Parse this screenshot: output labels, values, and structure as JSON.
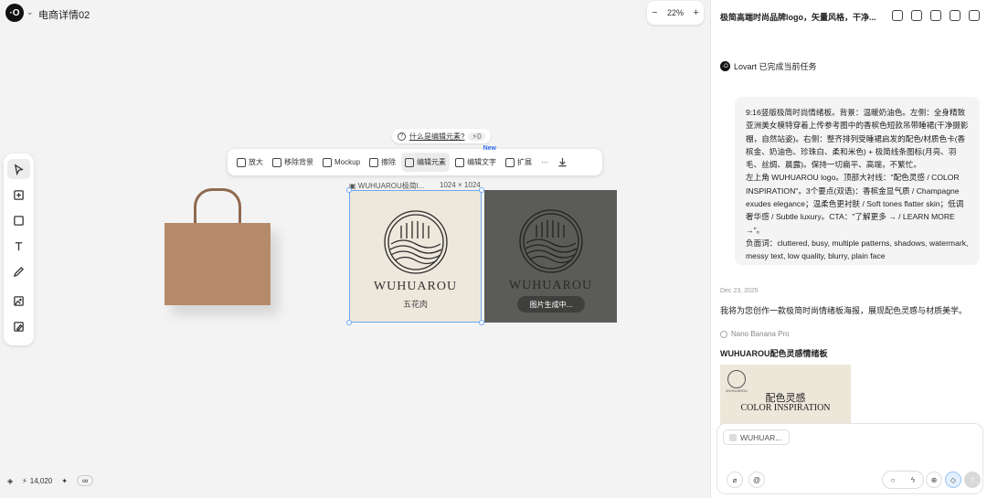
{
  "app": {
    "logo_text": "·O",
    "project_title": "电商详情02",
    "title_dropdown_icon": "chevron-down-icon"
  },
  "zoom": {
    "minus": "−",
    "level": "22%",
    "plus": "+"
  },
  "left_tools": [
    "cursor-icon",
    "add-frame-icon",
    "rectangle-icon",
    "text-icon",
    "pen-icon",
    "image-upload-icon",
    "image-edit-icon"
  ],
  "hint": {
    "question": "?",
    "text": "什么是编辑元素?",
    "cost": "⚡0"
  },
  "floatbar": {
    "items": [
      {
        "icon": "hd-icon",
        "label": "放大"
      },
      {
        "icon": "remove-bg-icon",
        "label": "移除背景"
      },
      {
        "icon": "mockup-icon",
        "label": "Mockup"
      },
      {
        "icon": "eraser-icon",
        "label": "擦除"
      },
      {
        "icon": "edit-elements-icon",
        "label": "编辑元素"
      },
      {
        "icon": "edit-text-icon",
        "label": "编辑文字",
        "badge": "New"
      },
      {
        "icon": "expand-icon",
        "label": "扩展"
      }
    ],
    "more": "···",
    "download_icon": "download-icon"
  },
  "canvas": {
    "image_label": "WUHUAROU极简l...",
    "image_size": "1024 × 1024",
    "brand_name": "WUHUAROU",
    "brand_cn": "五花肉",
    "generating": "图片生成中..."
  },
  "bottom": {
    "credits": "14,020",
    "bolt": "⚡",
    "infinity": "∞"
  },
  "panel": {
    "title": "极简高端时尚品牌logo，矢量风格，干净...",
    "status": "Lovart 已完成当前任务",
    "prompt_lines": [
      "9:16竖版极简时尚情绪板。背景：温暖奶油色。左侧：全身精致亚洲美女模特穿着上传参考图中的香槟色短款吊带睡裙(干净摄影棚，自然站姿)。右侧：整齐排列受睡裙启发的配色/材质色卡(香槟金、奶油色、珍珠白、柔和米色) + 极简线条图标(月亮、羽毛、丝绸、晨露)。保持一切扁平、高端，不繁忙。",
      "左上角 WUHUAROU logo。顶部大衬线：\"配色灵感 / COLOR INSPIRATION\"。3个要点(双语)：香槟金显气质 / Champagne exudes elegance；温柔色更衬肤 / Soft tones flatter skin；低调奢华感 / Subtle luxury。CTA：\"了解更多 → / LEARN MORE →\"。",
      "负面词：cluttered, busy, multiple patterns, shadows, watermark, messy text, low quality, blurry, plain face"
    ],
    "date": "Dec 23, 2025",
    "reply": "我将为您创作一款极简时尚情绪板海报，展现配色灵感与材质美学。",
    "model": "Nano Banana Pro",
    "result_title": "WUHUAROU配色灵感情绪板",
    "thumb": {
      "t1": "配色灵感",
      "t2": "COLOR INSPIRATION",
      "small": "WUHUAROU"
    },
    "chip": "WUHUAR...",
    "send_icon": "↑"
  }
}
